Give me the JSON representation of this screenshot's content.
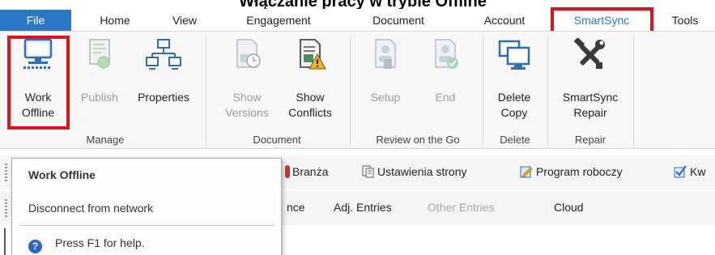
{
  "page_title": "Włączanie pracy w trybie Offline",
  "menu": {
    "tabs": [
      "File",
      "Home",
      "View",
      "Engagement",
      "Document",
      "Account",
      "SmartSync",
      "Tools"
    ]
  },
  "ribbon": {
    "manage": {
      "label": "Manage",
      "work_offline": [
        "Work",
        "Offline"
      ],
      "publish": "Publish",
      "properties": "Properties"
    },
    "document": {
      "label": "Document",
      "show_versions": [
        "Show",
        "Versions"
      ],
      "show_conflicts": [
        "Show",
        "Conflicts"
      ]
    },
    "review": {
      "label": "Review on the Go",
      "setup": "Setup",
      "end": "End"
    },
    "delete": {
      "label": "Delete",
      "delete_copy": [
        "Delete",
        "Copy"
      ]
    },
    "repair": {
      "label": "Repair",
      "smartsync_repair": [
        "SmartSync",
        "Repair"
      ]
    }
  },
  "toolbar1": {
    "branza": "Branża",
    "ustawienia": "Ustawienia strony",
    "program": "Program roboczy",
    "kw": "Kw"
  },
  "toolbar2": {
    "nce": "nce",
    "adj_entries": "Adj. Entries",
    "other_entries": "Other Entries",
    "cloud": "Cloud"
  },
  "tooltip": {
    "title": "Work Offline",
    "description": "Disconnect from network",
    "help": "Press F1 for help."
  },
  "colors": {
    "accent": "#2a78c4",
    "highlight": "#e0121e"
  }
}
